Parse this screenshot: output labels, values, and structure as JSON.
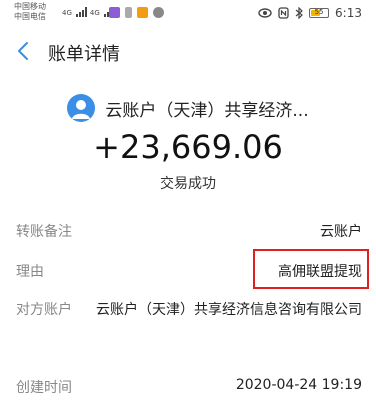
{
  "status_bar": {
    "carrier1": "中国移动",
    "carrier2": "中国电信",
    "signal_label1": "4G",
    "signal_label2": "4G",
    "time": "6:13",
    "battery_text": "55",
    "battery_level": 0.55
  },
  "nav": {
    "title": "账单详情"
  },
  "summary": {
    "payee": "云账户（天津）共享经济...",
    "amount": "+23,669.06",
    "status": "交易成功"
  },
  "details": {
    "remark": {
      "label": "转账备注",
      "value": "云账户"
    },
    "reason": {
      "label": "理由",
      "value": "高佣联盟提现"
    },
    "account": {
      "label": "对方账户",
      "value": "云账户（天津）共享经济信息咨询有限公司"
    },
    "created": {
      "label": "创建时间",
      "value": "2020-04-24 19:19"
    }
  },
  "colors": {
    "accent": "#3a8ee6",
    "highlight_box": "#e02020",
    "battery": "#f4b400"
  }
}
